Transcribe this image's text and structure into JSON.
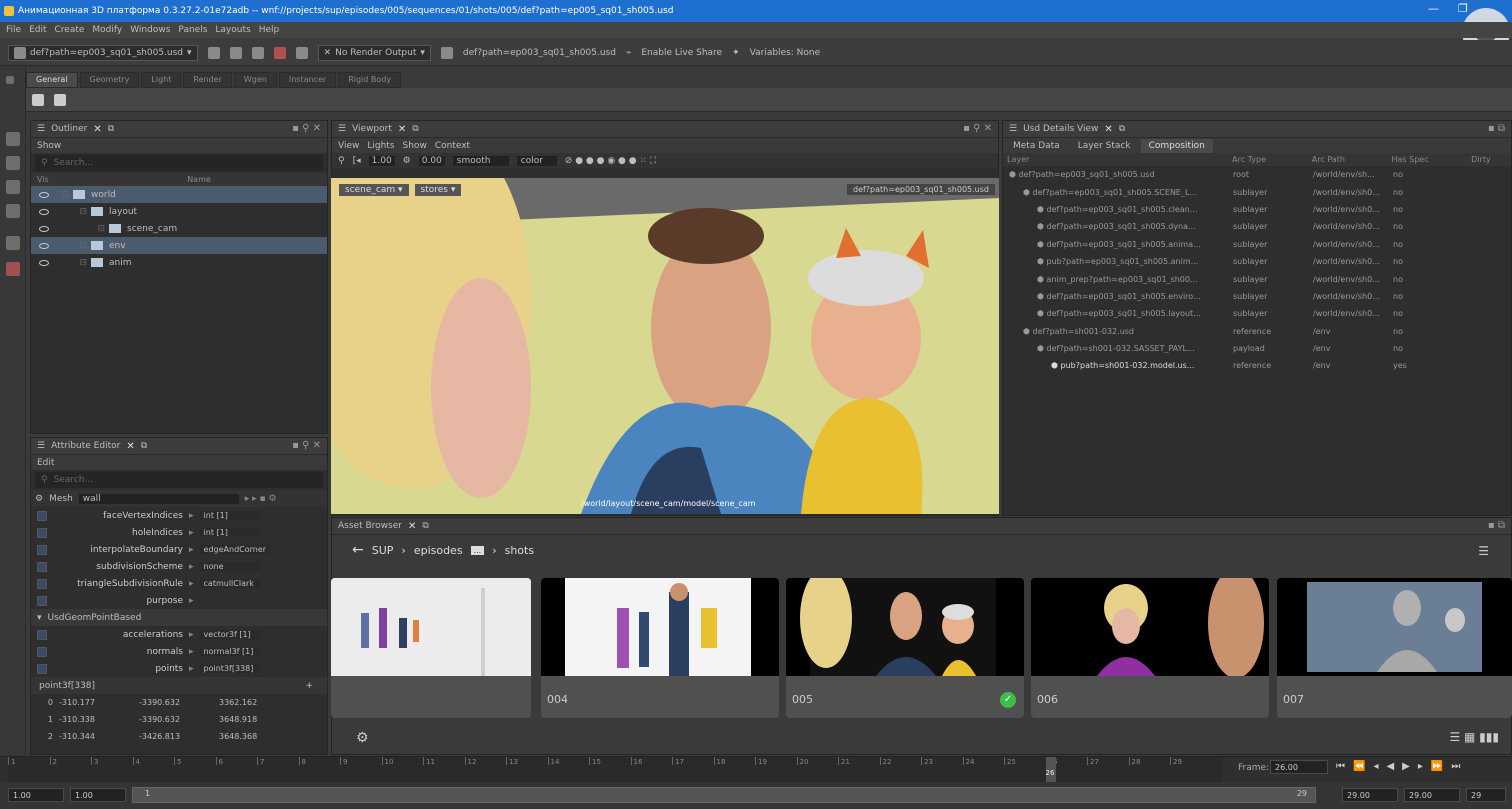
{
  "window": {
    "title": "Анимационная 3D платформа 0.3.27.2-01e72adb -- wnf://projects/sup/episodes/005/sequences/01/shots/005/def?path=ep005_sq01_sh005.usd",
    "controls": [
      "—",
      "❐",
      "✕"
    ]
  },
  "menu": [
    "File",
    "Edit",
    "Create",
    "Modify",
    "Windows",
    "Panels",
    "Layouts",
    "Help"
  ],
  "toolbar": {
    "stage_path": "def?path=ep003_sq01_sh005.usd",
    "render_output": "No Render Output",
    "layer_path": "def?path=ep003_sq01_sh005.usd",
    "live_share": "Enable Live Share",
    "variables": "Variables: None"
  },
  "shelf_tabs": [
    "General",
    "Geometry",
    "Light",
    "Render",
    "Wgen",
    "Instancer",
    "Rigid Body"
  ],
  "outliner": {
    "title": "Outliner",
    "menu": "Show",
    "search_placeholder": "Search...",
    "columns": [
      "Vis",
      "Name"
    ],
    "items": [
      {
        "name": "world",
        "depth": 0,
        "selected": true
      },
      {
        "name": "layout",
        "depth": 1,
        "selected": false
      },
      {
        "name": "scene_cam",
        "depth": 2,
        "selected": false
      },
      {
        "name": "env",
        "depth": 1,
        "selected": true
      },
      {
        "name": "anim",
        "depth": 1,
        "selected": false
      }
    ]
  },
  "attribute_editor": {
    "title": "Attribute Editor",
    "menu": "Edit",
    "search_placeholder": "Search...",
    "node_type": "Mesh",
    "node_name": "wall",
    "attributes": [
      {
        "name": "faceVertexIndices",
        "value": "int [1]"
      },
      {
        "name": "holeIndices",
        "value": "int [1]"
      },
      {
        "name": "interpolateBoundary",
        "value": "edgeAndCorner"
      },
      {
        "name": "subdivisionScheme",
        "value": "none"
      },
      {
        "name": "triangleSubdivisionRule",
        "value": "catmullClark"
      },
      {
        "name": "purpose",
        "value": ""
      }
    ],
    "section": "UsdGeomPointBased",
    "section_attributes": [
      {
        "name": "accelerations",
        "value": "vector3f [1]"
      },
      {
        "name": "normals",
        "value": "normal3f [1]"
      },
      {
        "name": "points",
        "value": "point3f[338]"
      }
    ],
    "array_title": "point3f[338]",
    "array_rows": [
      {
        "i": "0",
        "x": "-310.177",
        "y": "-3390.632",
        "z": "3362.162"
      },
      {
        "i": "1",
        "x": "-310.338",
        "y": "-3390.632",
        "z": "3648.918"
      },
      {
        "i": "2",
        "x": "-310.344",
        "y": "-3426.813",
        "z": "3648.368"
      }
    ]
  },
  "viewport": {
    "title": "Viewport",
    "menus": [
      "View",
      "Lights",
      "Show",
      "Context"
    ],
    "exposure": "1.00",
    "gamma": "0.00",
    "shading": "smooth",
    "color_mode": "color",
    "camera": "scene_cam",
    "display_mode": "stores",
    "layer_label": "def?path=ep003_sq01_sh005.usd",
    "camera_path": "/world/layout/scene_cam/model/scene_cam"
  },
  "usd_details": {
    "title": "Usd Details View",
    "tabs": [
      "Meta Data",
      "Layer Stack",
      "Composition"
    ],
    "columns": [
      "Layer",
      "Arc Type",
      "Arc Path",
      "Has Spec",
      "Dirty"
    ],
    "rows": [
      {
        "layer": "def?path=ep003_sq01_sh005.usd",
        "arc": "root",
        "path": "/world/env/sh...",
        "spec": "no"
      },
      {
        "layer": "def?path=ep003_sq01_sh005.SCENE_L...",
        "arc": "sublayer",
        "path": "/world/env/sh0...",
        "spec": "no"
      },
      {
        "layer": "def?path=ep003_sq01_sh005.clean...",
        "arc": "sublayer",
        "path": "/world/env/sh0...",
        "spec": "no"
      },
      {
        "layer": "def?path=ep003_sq01_sh005.dyna...",
        "arc": "sublayer",
        "path": "/world/env/sh0...",
        "spec": "no"
      },
      {
        "layer": "def?path=ep003_sq01_sh005.anima...",
        "arc": "sublayer",
        "path": "/world/env/sh0...",
        "spec": "no"
      },
      {
        "layer": "pub?path=ep003_sq01_sh005.anim...",
        "arc": "sublayer",
        "path": "/world/env/sh0...",
        "spec": "no"
      },
      {
        "layer": "anim_prep?path=ep003_sq01_sh00...",
        "arc": "sublayer",
        "path": "/world/env/sh0...",
        "spec": "no"
      },
      {
        "layer": "def?path=ep003_sq01_sh005.enviro...",
        "arc": "sublayer",
        "path": "/world/env/sh0...",
        "spec": "no"
      },
      {
        "layer": "def?path=ep003_sq01_sh005.layout...",
        "arc": "sublayer",
        "path": "/world/env/sh0...",
        "spec": "no"
      },
      {
        "layer": "def?path=sh001-032.usd",
        "arc": "reference",
        "path": "/env",
        "spec": "no"
      },
      {
        "layer": "def?path=sh001-032.SASSET_PAYL...",
        "arc": "payload",
        "path": "/env",
        "spec": "no"
      },
      {
        "layer": "pub?path=sh001-032.model.us...",
        "arc": "reference",
        "path": "/env",
        "spec": "yes"
      }
    ]
  },
  "asset_browser": {
    "title": "Asset Browser",
    "breadcrumb": [
      "SUP",
      "episodes",
      "...",
      "shots"
    ],
    "shots": [
      {
        "label": ""
      },
      {
        "label": "004"
      },
      {
        "label": "005",
        "checked": true
      },
      {
        "label": "006"
      },
      {
        "label": "007"
      }
    ]
  },
  "timeline": {
    "ticks": [
      "1",
      "2",
      "3",
      "4",
      "5",
      "6",
      "7",
      "8",
      "9",
      "10",
      "11",
      "12",
      "13",
      "14",
      "15",
      "16",
      "17",
      "18",
      "19",
      "20",
      "21",
      "22",
      "23",
      "24",
      "25",
      "26",
      "27",
      "28",
      "29"
    ],
    "current": "26",
    "frame_label": "Frame:",
    "frame_value": "26.00",
    "start_a": "1.00",
    "start_b": "1.00",
    "range_start": "1",
    "range_end": "29",
    "end_a": "29.00",
    "end_b": "29.00",
    "end_c": "29"
  },
  "colors": {
    "title_bar": "#1f6fd0",
    "selection": "#4b5a6d",
    "check": "#3bbf4a"
  }
}
